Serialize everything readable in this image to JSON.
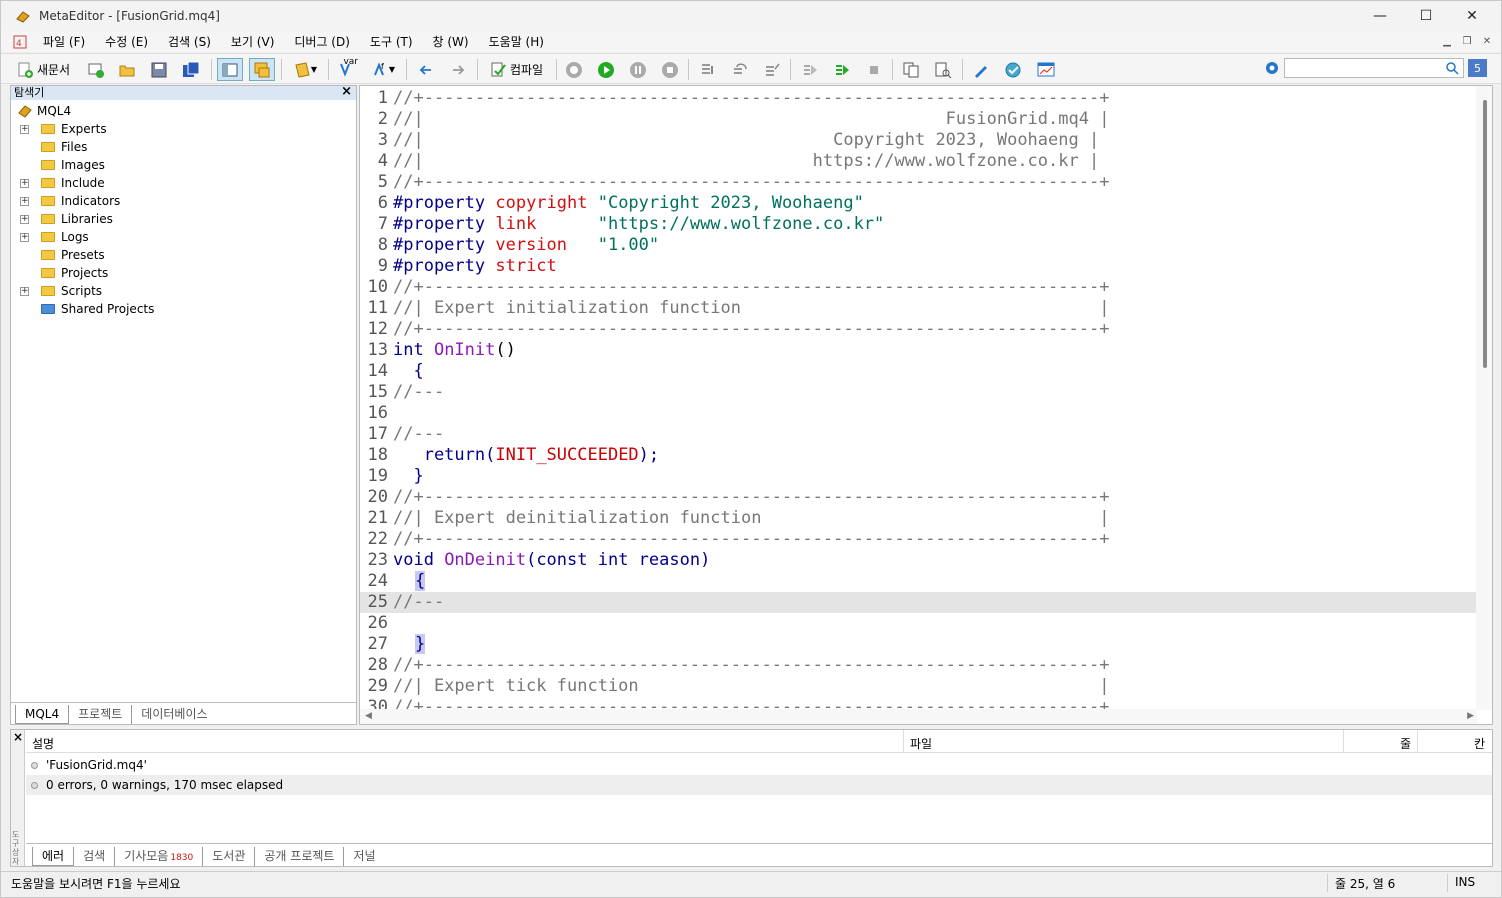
{
  "window": {
    "title": "MetaEditor - [FusionGrid.mq4]",
    "minimize": "—",
    "maximize": "☐",
    "close": "✕"
  },
  "menu": [
    "파일 (F)",
    "수정 (E)",
    "검색 (S)",
    "보기 (V)",
    "디버그 (D)",
    "도구 (T)",
    "창 (W)",
    "도움말 (H)"
  ],
  "toolbar": {
    "new_label": "새문서",
    "compile_label": "컴파일",
    "var_label": "var",
    "search_placeholder": "",
    "search_badge": "5"
  },
  "navigator": {
    "title": "탐색기",
    "close": "×",
    "root": "MQL4",
    "items": [
      {
        "label": "Experts",
        "expandable": true
      },
      {
        "label": "Files",
        "expandable": false
      },
      {
        "label": "Images",
        "expandable": false
      },
      {
        "label": "Include",
        "expandable": true
      },
      {
        "label": "Indicators",
        "expandable": true
      },
      {
        "label": "Libraries",
        "expandable": true
      },
      {
        "label": "Logs",
        "expandable": true
      },
      {
        "label": "Presets",
        "expandable": false
      },
      {
        "label": "Projects",
        "expandable": false
      },
      {
        "label": "Scripts",
        "expandable": true
      },
      {
        "label": "Shared Projects",
        "expandable": false
      }
    ],
    "tabs": [
      "MQL4",
      "프로젝트",
      "데이터베이스"
    ]
  },
  "editor": {
    "lines": [
      {
        "n": "1",
        "t": "//+------------------------------------------------------------------+"
      },
      {
        "n": "2",
        "t": "//|                                                   FusionGrid.mq4 |"
      },
      {
        "n": "3",
        "t": "//|                                        Copyright 2023, Woohaeng |"
      },
      {
        "n": "4",
        "t": "//|                                      https://www.wolfzone.co.kr |"
      },
      {
        "n": "5",
        "t": "//+------------------------------------------------------------------+"
      },
      {
        "n": "6",
        "a": "#property ",
        "b": "copyright ",
        "c": "\"Copyright 2023, Woohaeng\""
      },
      {
        "n": "7",
        "a": "#property ",
        "b": "link      ",
        "c": "\"https://www.wolfzone.co.kr\""
      },
      {
        "n": "8",
        "a": "#property ",
        "b": "version   ",
        "c": "\"1.00\""
      },
      {
        "n": "9",
        "a": "#property ",
        "b": "strict",
        "c": ""
      },
      {
        "n": "10",
        "t": "//+------------------------------------------------------------------+"
      },
      {
        "n": "11",
        "t": "//| Expert initialization function                                   |"
      },
      {
        "n": "12",
        "t": "//+------------------------------------------------------------------+"
      },
      {
        "n": "13",
        "kw": "int ",
        "fn": "OnInit",
        "rest": "()"
      },
      {
        "n": "14",
        "plain": "  {"
      },
      {
        "n": "15",
        "t": "//---"
      },
      {
        "n": "16",
        "plain": ""
      },
      {
        "n": "17",
        "t": "//---"
      },
      {
        "n": "18",
        "ret": "   return",
        "p1": "(",
        "const": "INIT_SUCCEEDED",
        "p2": ");"
      },
      {
        "n": "19",
        "plain": "  }"
      },
      {
        "n": "20",
        "t": "//+------------------------------------------------------------------+"
      },
      {
        "n": "21",
        "t": "//| Expert deinitialization function                                 |"
      },
      {
        "n": "22",
        "t": "//+------------------------------------------------------------------+"
      },
      {
        "n": "23",
        "kw": "void ",
        "fn": "OnDeinit",
        "rest": "(const int reason)"
      },
      {
        "n": "24",
        "brace": "{"
      },
      {
        "n": "25",
        "t": "//---"
      },
      {
        "n": "26",
        "plain": ""
      },
      {
        "n": "27",
        "brace": "}"
      },
      {
        "n": "28",
        "t": "//+------------------------------------------------------------------+"
      },
      {
        "n": "29",
        "t": "//| Expert tick function                                             |"
      },
      {
        "n": "30",
        "t": "//+------------------------------------------------------------------+"
      }
    ]
  },
  "toolbox": {
    "columns": {
      "desc": "설명",
      "file": "파일",
      "line": "줄",
      "col": "칸"
    },
    "rows": [
      "'FusionGrid.mq4'",
      "0 errors, 0 warnings, 170 msec elapsed"
    ],
    "side_label": "도구상자",
    "close": "×",
    "tabs": [
      "에러",
      "검색",
      "기사모음",
      "도서관",
      "공개 프로젝트",
      "저널"
    ],
    "articles_badge": "1830"
  },
  "status": {
    "help": "도움말을 보시려면 F1을 누르세요",
    "position": "줄 25, 열 6",
    "mode": "INS"
  }
}
